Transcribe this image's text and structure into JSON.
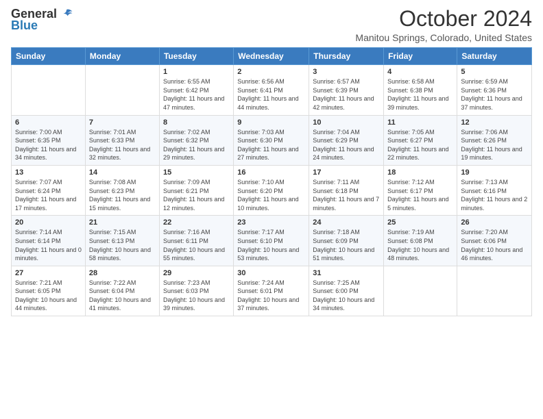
{
  "logo": {
    "general": "General",
    "blue": "Blue"
  },
  "header": {
    "month": "October 2024",
    "location": "Manitou Springs, Colorado, United States"
  },
  "weekdays": [
    "Sunday",
    "Monday",
    "Tuesday",
    "Wednesday",
    "Thursday",
    "Friday",
    "Saturday"
  ],
  "weeks": [
    [
      {
        "day": "",
        "detail": ""
      },
      {
        "day": "",
        "detail": ""
      },
      {
        "day": "1",
        "detail": "Sunrise: 6:55 AM\nSunset: 6:42 PM\nDaylight: 11 hours and 47 minutes."
      },
      {
        "day": "2",
        "detail": "Sunrise: 6:56 AM\nSunset: 6:41 PM\nDaylight: 11 hours and 44 minutes."
      },
      {
        "day": "3",
        "detail": "Sunrise: 6:57 AM\nSunset: 6:39 PM\nDaylight: 11 hours and 42 minutes."
      },
      {
        "day": "4",
        "detail": "Sunrise: 6:58 AM\nSunset: 6:38 PM\nDaylight: 11 hours and 39 minutes."
      },
      {
        "day": "5",
        "detail": "Sunrise: 6:59 AM\nSunset: 6:36 PM\nDaylight: 11 hours and 37 minutes."
      }
    ],
    [
      {
        "day": "6",
        "detail": "Sunrise: 7:00 AM\nSunset: 6:35 PM\nDaylight: 11 hours and 34 minutes."
      },
      {
        "day": "7",
        "detail": "Sunrise: 7:01 AM\nSunset: 6:33 PM\nDaylight: 11 hours and 32 minutes."
      },
      {
        "day": "8",
        "detail": "Sunrise: 7:02 AM\nSunset: 6:32 PM\nDaylight: 11 hours and 29 minutes."
      },
      {
        "day": "9",
        "detail": "Sunrise: 7:03 AM\nSunset: 6:30 PM\nDaylight: 11 hours and 27 minutes."
      },
      {
        "day": "10",
        "detail": "Sunrise: 7:04 AM\nSunset: 6:29 PM\nDaylight: 11 hours and 24 minutes."
      },
      {
        "day": "11",
        "detail": "Sunrise: 7:05 AM\nSunset: 6:27 PM\nDaylight: 11 hours and 22 minutes."
      },
      {
        "day": "12",
        "detail": "Sunrise: 7:06 AM\nSunset: 6:26 PM\nDaylight: 11 hours and 19 minutes."
      }
    ],
    [
      {
        "day": "13",
        "detail": "Sunrise: 7:07 AM\nSunset: 6:24 PM\nDaylight: 11 hours and 17 minutes."
      },
      {
        "day": "14",
        "detail": "Sunrise: 7:08 AM\nSunset: 6:23 PM\nDaylight: 11 hours and 15 minutes."
      },
      {
        "day": "15",
        "detail": "Sunrise: 7:09 AM\nSunset: 6:21 PM\nDaylight: 11 hours and 12 minutes."
      },
      {
        "day": "16",
        "detail": "Sunrise: 7:10 AM\nSunset: 6:20 PM\nDaylight: 11 hours and 10 minutes."
      },
      {
        "day": "17",
        "detail": "Sunrise: 7:11 AM\nSunset: 6:18 PM\nDaylight: 11 hours and 7 minutes."
      },
      {
        "day": "18",
        "detail": "Sunrise: 7:12 AM\nSunset: 6:17 PM\nDaylight: 11 hours and 5 minutes."
      },
      {
        "day": "19",
        "detail": "Sunrise: 7:13 AM\nSunset: 6:16 PM\nDaylight: 11 hours and 2 minutes."
      }
    ],
    [
      {
        "day": "20",
        "detail": "Sunrise: 7:14 AM\nSunset: 6:14 PM\nDaylight: 11 hours and 0 minutes."
      },
      {
        "day": "21",
        "detail": "Sunrise: 7:15 AM\nSunset: 6:13 PM\nDaylight: 10 hours and 58 minutes."
      },
      {
        "day": "22",
        "detail": "Sunrise: 7:16 AM\nSunset: 6:11 PM\nDaylight: 10 hours and 55 minutes."
      },
      {
        "day": "23",
        "detail": "Sunrise: 7:17 AM\nSunset: 6:10 PM\nDaylight: 10 hours and 53 minutes."
      },
      {
        "day": "24",
        "detail": "Sunrise: 7:18 AM\nSunset: 6:09 PM\nDaylight: 10 hours and 51 minutes."
      },
      {
        "day": "25",
        "detail": "Sunrise: 7:19 AM\nSunset: 6:08 PM\nDaylight: 10 hours and 48 minutes."
      },
      {
        "day": "26",
        "detail": "Sunrise: 7:20 AM\nSunset: 6:06 PM\nDaylight: 10 hours and 46 minutes."
      }
    ],
    [
      {
        "day": "27",
        "detail": "Sunrise: 7:21 AM\nSunset: 6:05 PM\nDaylight: 10 hours and 44 minutes."
      },
      {
        "day": "28",
        "detail": "Sunrise: 7:22 AM\nSunset: 6:04 PM\nDaylight: 10 hours and 41 minutes."
      },
      {
        "day": "29",
        "detail": "Sunrise: 7:23 AM\nSunset: 6:03 PM\nDaylight: 10 hours and 39 minutes."
      },
      {
        "day": "30",
        "detail": "Sunrise: 7:24 AM\nSunset: 6:01 PM\nDaylight: 10 hours and 37 minutes."
      },
      {
        "day": "31",
        "detail": "Sunrise: 7:25 AM\nSunset: 6:00 PM\nDaylight: 10 hours and 34 minutes."
      },
      {
        "day": "",
        "detail": ""
      },
      {
        "day": "",
        "detail": ""
      }
    ]
  ]
}
